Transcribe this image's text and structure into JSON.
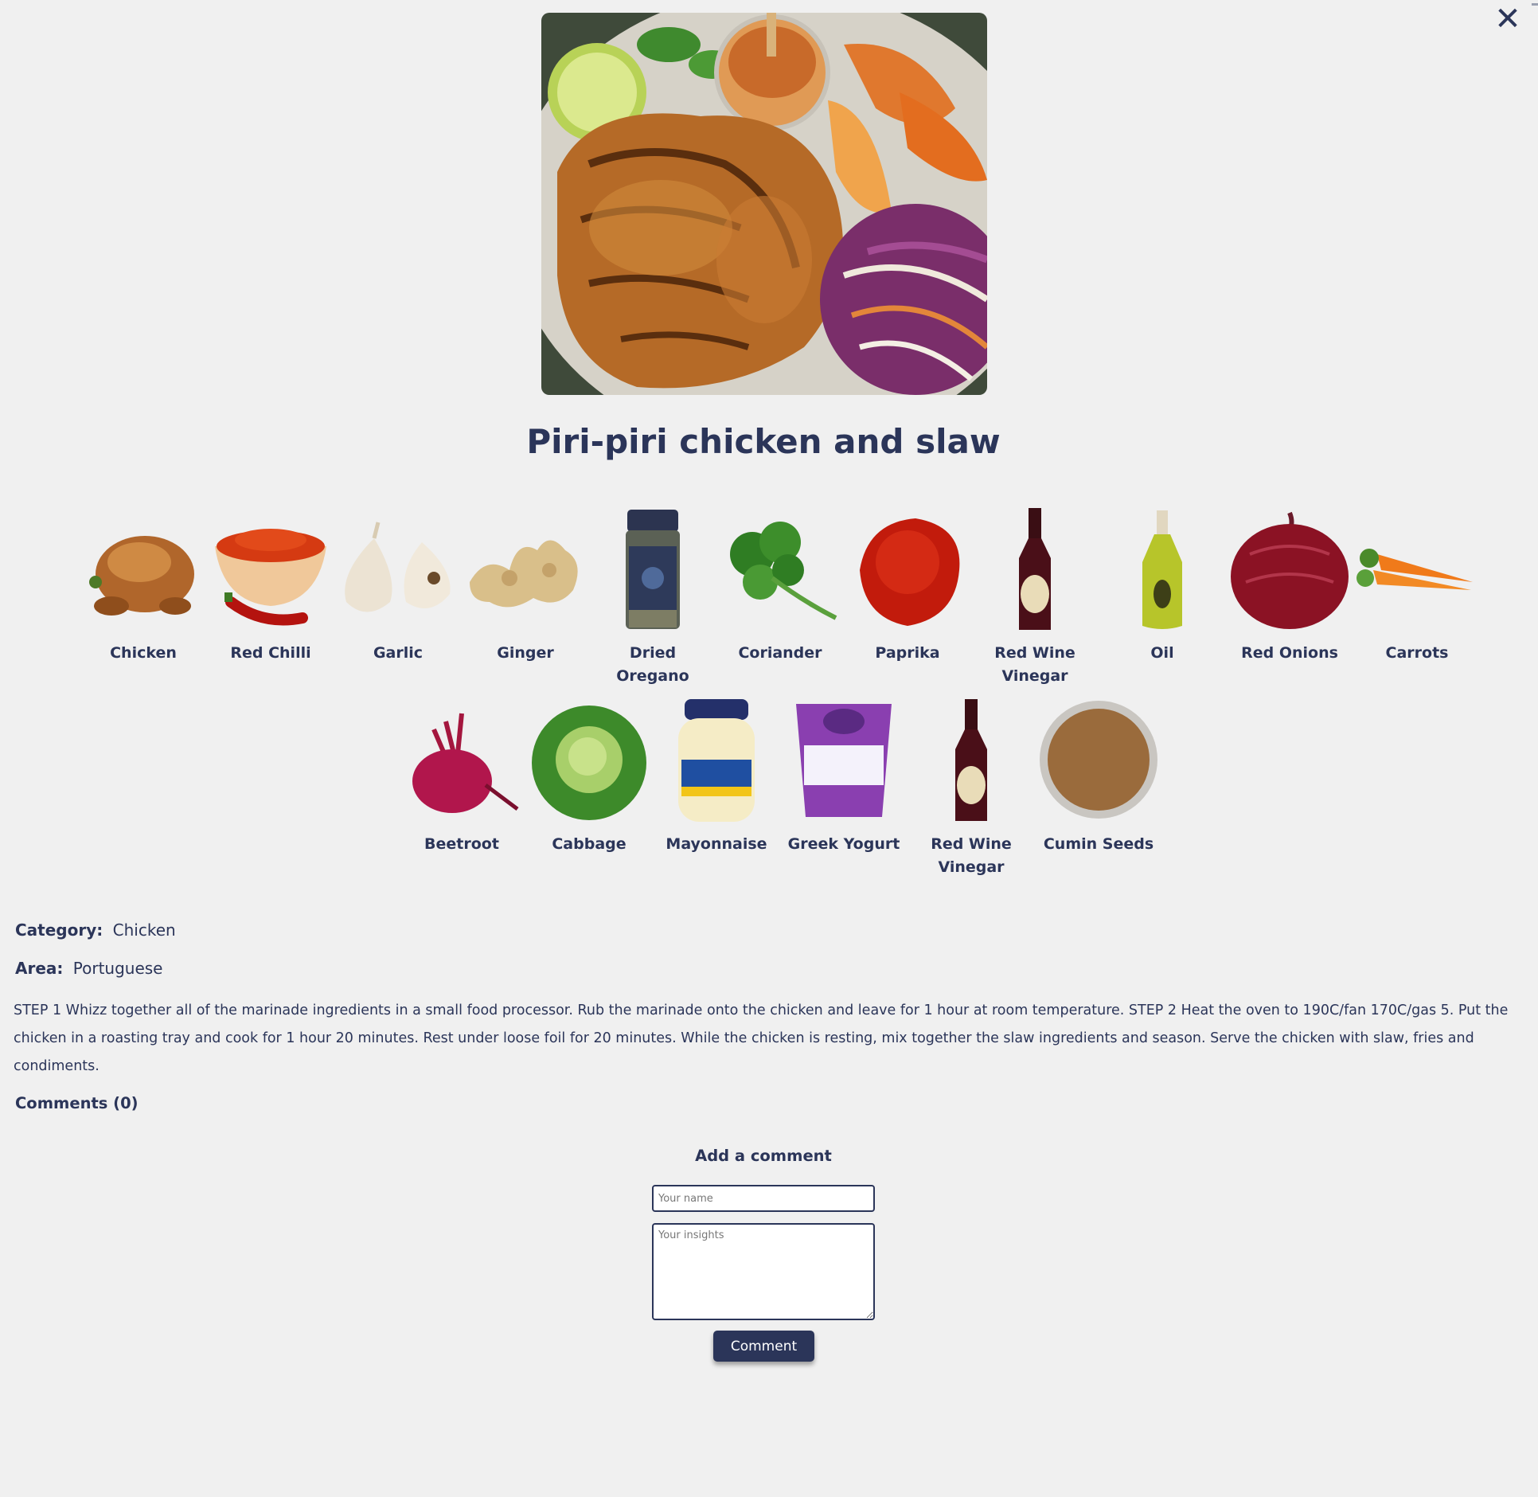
{
  "recipe": {
    "title": "Piri-piri chicken and slaw",
    "category_label": "Category:",
    "category": "Chicken",
    "area_label": "Area:",
    "area": "Portuguese",
    "instructions": "STEP 1 Whizz together all of the marinade ingredients in a small food processor. Rub the marinade onto the chicken and leave for 1 hour at room temperature. STEP 2 Heat the oven to 190C/fan 170C/gas 5. Put the chicken in a roasting tray and cook for 1 hour 20 minutes. Rest under loose foil for 20 minutes. While the chicken is resting, mix together the slaw ingredients and season. Serve the chicken with slaw, fries and condiments."
  },
  "ingredients": [
    {
      "name": "Chicken",
      "icon": "roast-chicken-icon"
    },
    {
      "name": "Red Chilli",
      "icon": "chilli-powder-bowl-icon"
    },
    {
      "name": "Garlic",
      "icon": "garlic-icon"
    },
    {
      "name": "Ginger",
      "icon": "ginger-root-icon"
    },
    {
      "name": "Dried Oregano",
      "icon": "oregano-jar-icon"
    },
    {
      "name": "Coriander",
      "icon": "coriander-bunch-icon"
    },
    {
      "name": "Paprika",
      "icon": "paprika-powder-icon"
    },
    {
      "name": "Red Wine Vinegar",
      "icon": "vinegar-bottle-icon"
    },
    {
      "name": "Oil",
      "icon": "oil-bottle-icon"
    },
    {
      "name": "Red Onions",
      "icon": "red-onion-icon"
    },
    {
      "name": "Carrots",
      "icon": "carrots-icon"
    },
    {
      "name": "Beetroot",
      "icon": "beetroot-icon"
    },
    {
      "name": "Cabbage",
      "icon": "cabbage-icon"
    },
    {
      "name": "Mayonnaise",
      "icon": "mayonnaise-jar-icon"
    },
    {
      "name": "Greek Yogurt",
      "icon": "yogurt-tub-icon"
    },
    {
      "name": "Red Wine Vinegar",
      "icon": "vinegar-bottle-icon"
    },
    {
      "name": "Cumin Seeds",
      "icon": "cumin-bowl-icon"
    }
  ],
  "comments": {
    "heading": "Comments (0)",
    "add_heading": "Add a comment",
    "name_placeholder": "Your name",
    "insights_placeholder": "Your insights",
    "submit_label": "Comment"
  },
  "close_icon": "close-icon",
  "colors": {
    "background": "#f0f0f0",
    "navy": "#2b3559"
  }
}
